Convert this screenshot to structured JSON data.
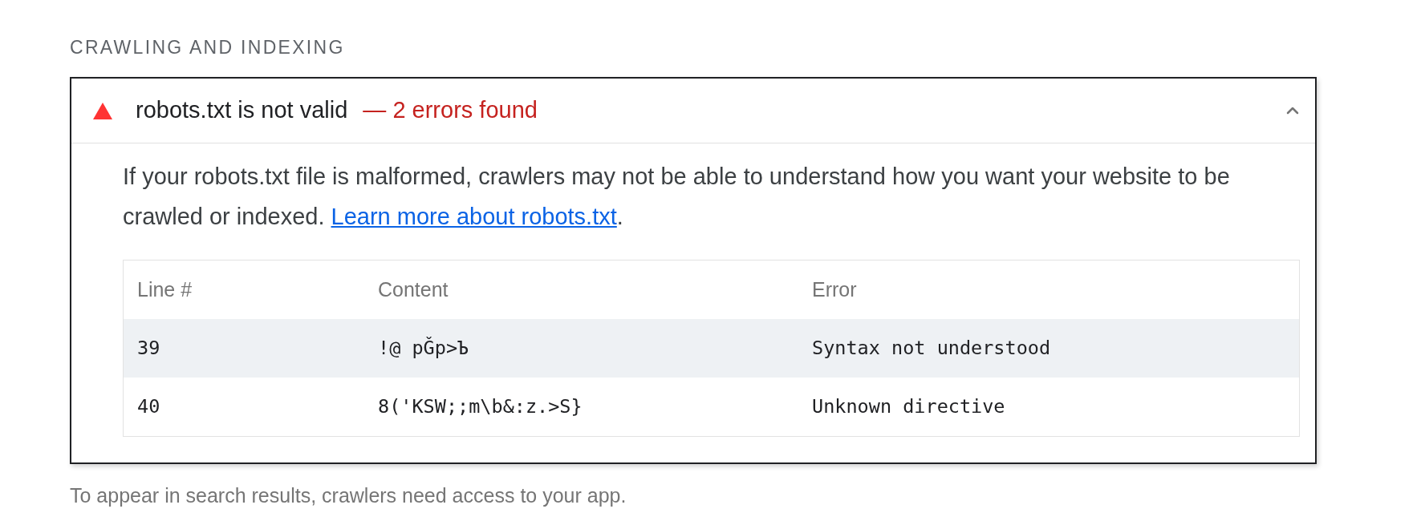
{
  "section_title": "CRAWLING AND INDEXING",
  "audit": {
    "kind": "fail",
    "title": "robots.txt is not valid",
    "display_value": "— 2 errors found",
    "expanded": true,
    "description": "If your robots.txt file is malformed, crawlers may not be able to understand how you want your website to be crawled or indexed. ",
    "link": "Learn more about robots.txt",
    "description_end": ".",
    "table": {
      "columns": [
        "Line #",
        "Content",
        "Error"
      ],
      "rows": [
        {
          "cells": [
            "39",
            "!@ pǦp>Ъ",
            "Syntax not understood"
          ]
        },
        {
          "cells": [
            "40",
            "8('KSW;;m\\b&:z.>S}",
            "Unknown directive"
          ]
        }
      ]
    }
  },
  "footer": "To appear in search results, crawlers need access to your app."
}
